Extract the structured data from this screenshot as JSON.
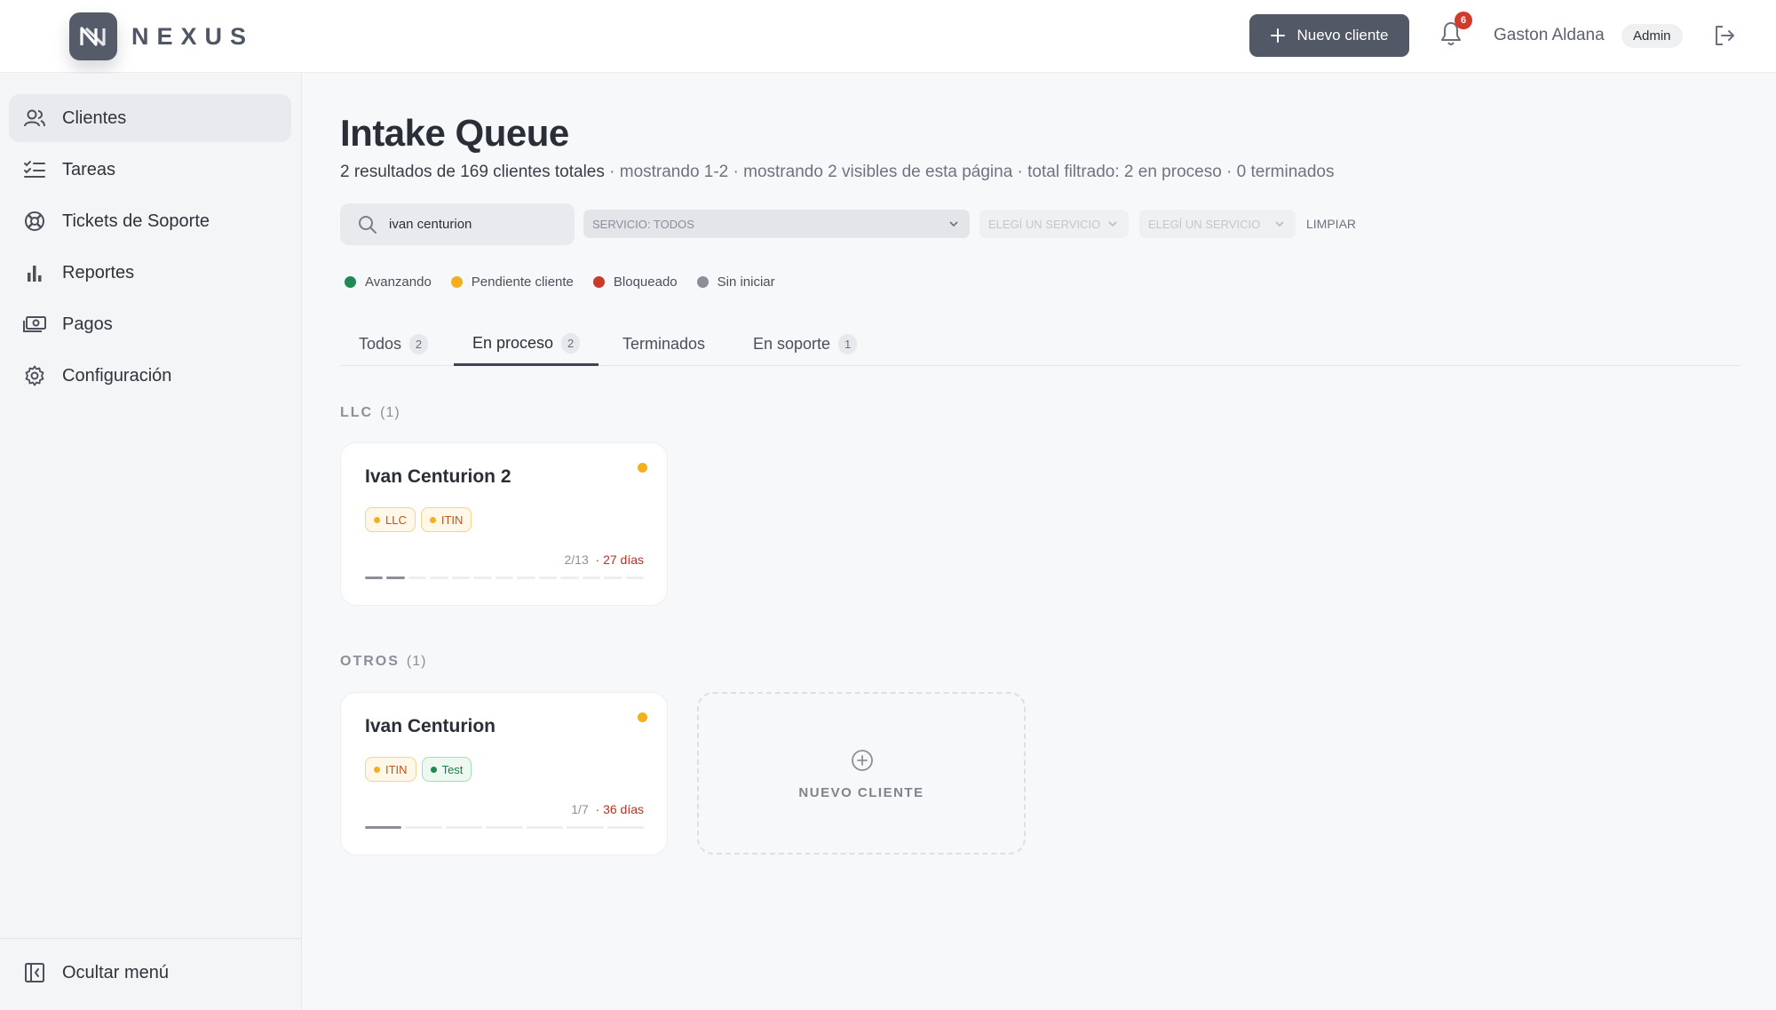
{
  "header": {
    "brand": "NEXUS",
    "new_client_label": "Nuevo cliente",
    "notifications_count": "6",
    "user_name": "Gaston Aldana",
    "user_role": "Admin"
  },
  "sidebar": {
    "items": [
      {
        "label": "Clientes",
        "icon": "users-icon",
        "active": true
      },
      {
        "label": "Tareas",
        "icon": "task-list-icon"
      },
      {
        "label": "Tickets de Soporte",
        "icon": "lifebuoy-icon"
      },
      {
        "label": "Reportes",
        "icon": "bar-chart-icon"
      },
      {
        "label": "Pagos",
        "icon": "money-icon"
      },
      {
        "label": "Configuración",
        "icon": "gear-icon"
      }
    ],
    "collapse_label": "Ocultar menú"
  },
  "page": {
    "title": "Intake Queue",
    "subtitle_main": "2 resultados de 169 clientes totales",
    "subtitle_rest": " · mostrando 1-2 · mostrando 2 visibles de esta página · total filtrado: 2 en proceso · 0 terminados"
  },
  "filters": {
    "search_value": "ivan centurion",
    "service_select": "Servicio: Todos",
    "select_2": "Elegí un servicio",
    "select_3": "Elegí un servicio",
    "clear_label": "Limpiar"
  },
  "legend": [
    {
      "label": "Avanzando",
      "color": "#1f8a56"
    },
    {
      "label": "Pendiente cliente",
      "color": "#f2b01e"
    },
    {
      "label": "Bloqueado",
      "color": "#c93a2a"
    },
    {
      "label": "Sin iniciar",
      "color": "#8a8f99"
    }
  ],
  "tabs": [
    {
      "label": "Todos",
      "count": "2"
    },
    {
      "label": "En proceso",
      "count": "2",
      "active": true
    },
    {
      "label": "Terminados"
    },
    {
      "label": "En soporte",
      "count": "1"
    }
  ],
  "groups": [
    {
      "name": "LLC",
      "count": "(1)",
      "cards": [
        {
          "name": "Ivan Centurion 2",
          "tags": [
            {
              "label": "LLC"
            },
            {
              "label": "ITIN"
            }
          ],
          "progress": "2/13",
          "days": "· 27 días",
          "done": 2,
          "total": 13
        }
      ]
    },
    {
      "name": "OTROS",
      "count": "(1)",
      "cards": [
        {
          "name": "Ivan Centurion",
          "tags": [
            {
              "label": "ITIN"
            },
            {
              "label": "Test"
            }
          ],
          "progress": "1/7",
          "days": "· 36 días",
          "done": 1,
          "total": 7
        }
      ]
    }
  ],
  "new_card_label": "NUEVO CLIENTE"
}
